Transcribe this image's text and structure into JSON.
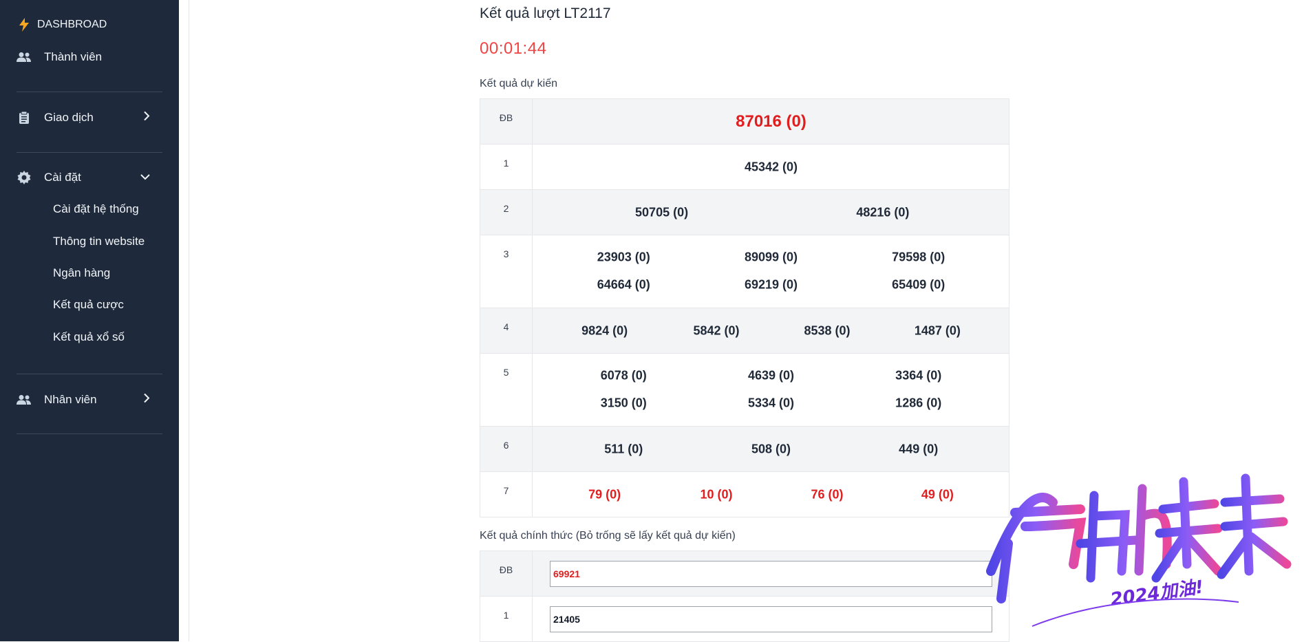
{
  "sidebar": {
    "dashboard": "DASHBROAD",
    "members": "Thành viên",
    "transactions": "Giao dịch",
    "settings": "Cài đặt",
    "sub_items": [
      "Cài đặt hệ thống",
      "Thông tin website",
      "Ngân hàng",
      "Kết quả cược",
      "Kết quả xổ số"
    ],
    "staff": "Nhân viên"
  },
  "main": {
    "title": "Kết quả lượt LT2117",
    "timer": "00:01:44",
    "expected_label": "Kết quả dự kiến",
    "official_label": "Kết quả chính thức (Bỏ trống sẽ lấy kết quả dự kiến)"
  },
  "expected": {
    "db": {
      "prize": "ĐB",
      "values": [
        "87016 (0)"
      ]
    },
    "p1": {
      "prize": "1",
      "values": [
        "45342 (0)"
      ]
    },
    "p2": {
      "prize": "2",
      "values": [
        "50705 (0)",
        "48216 (0)"
      ]
    },
    "p3": {
      "prize": "3",
      "values": [
        "23903 (0)",
        "89099 (0)",
        "79598 (0)",
        "64664 (0)",
        "69219 (0)",
        "65409 (0)"
      ]
    },
    "p4": {
      "prize": "4",
      "values": [
        "9824 (0)",
        "5842 (0)",
        "8538 (0)",
        "1487 (0)"
      ]
    },
    "p5": {
      "prize": "5",
      "values": [
        "6078 (0)",
        "4639 (0)",
        "3364 (0)",
        "3150 (0)",
        "5334 (0)",
        "1286 (0)"
      ]
    },
    "p6": {
      "prize": "6",
      "values": [
        "511 (0)",
        "508 (0)",
        "449 (0)"
      ]
    },
    "p7": {
      "prize": "7",
      "values": [
        "79 (0)",
        "10 (0)",
        "76 (0)",
        "49 (0)"
      ]
    }
  },
  "official": {
    "db": {
      "prize": "ĐB",
      "value": "69921"
    },
    "p1": {
      "prize": "1",
      "value": "21405"
    }
  },
  "watermark": {
    "main": "启航未来",
    "sub": "2024加油!"
  },
  "colors": {
    "sidebar_bg": "#1e293b",
    "accent_red": "#e11d1d",
    "timer_red": "#ef4444",
    "alt_row": "#f3f4f6"
  }
}
